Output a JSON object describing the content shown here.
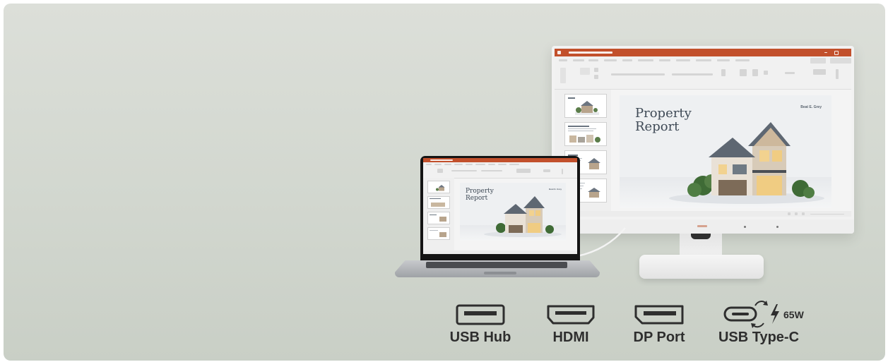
{
  "slide": {
    "title_line1": "Property",
    "title_line2": "Report",
    "author": "Beat E. Grey"
  },
  "ports": [
    {
      "label": "USB Hub",
      "icon": "usb-port-icon"
    },
    {
      "label": "HDMI",
      "icon": "hdmi-port-icon"
    },
    {
      "label": "DP Port",
      "icon": "displayport-icon"
    },
    {
      "label": "USB Type-C",
      "icon": "usb-c-port-icon"
    }
  ],
  "power": {
    "watts": "65W",
    "icon": "lightning-bolt-icon"
  },
  "colors": {
    "app_accent": "#c2502c",
    "background": "#d3d8d0",
    "text": "#2e2e2e"
  }
}
